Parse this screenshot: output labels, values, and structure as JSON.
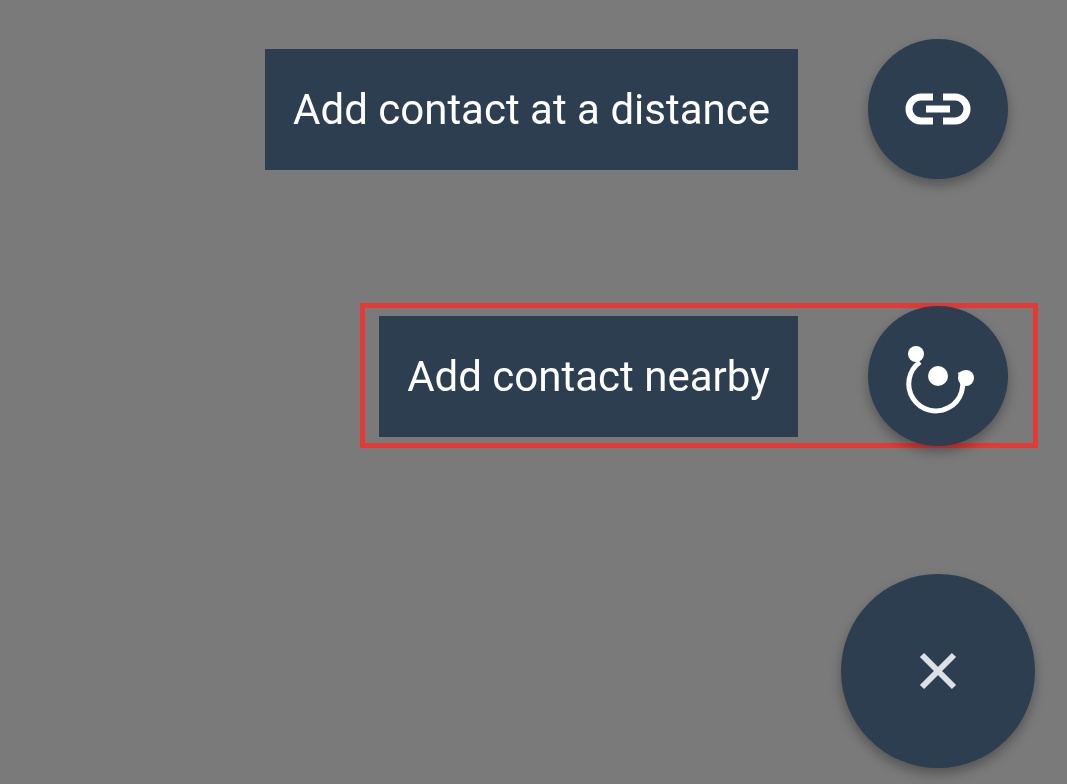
{
  "actions": [
    {
      "label": "Add contact at a distance",
      "kind": "link",
      "highlighted": false
    },
    {
      "label": "Add contact nearby",
      "kind": "nearby",
      "highlighted": true
    }
  ],
  "close_button": {
    "kind": "close"
  }
}
